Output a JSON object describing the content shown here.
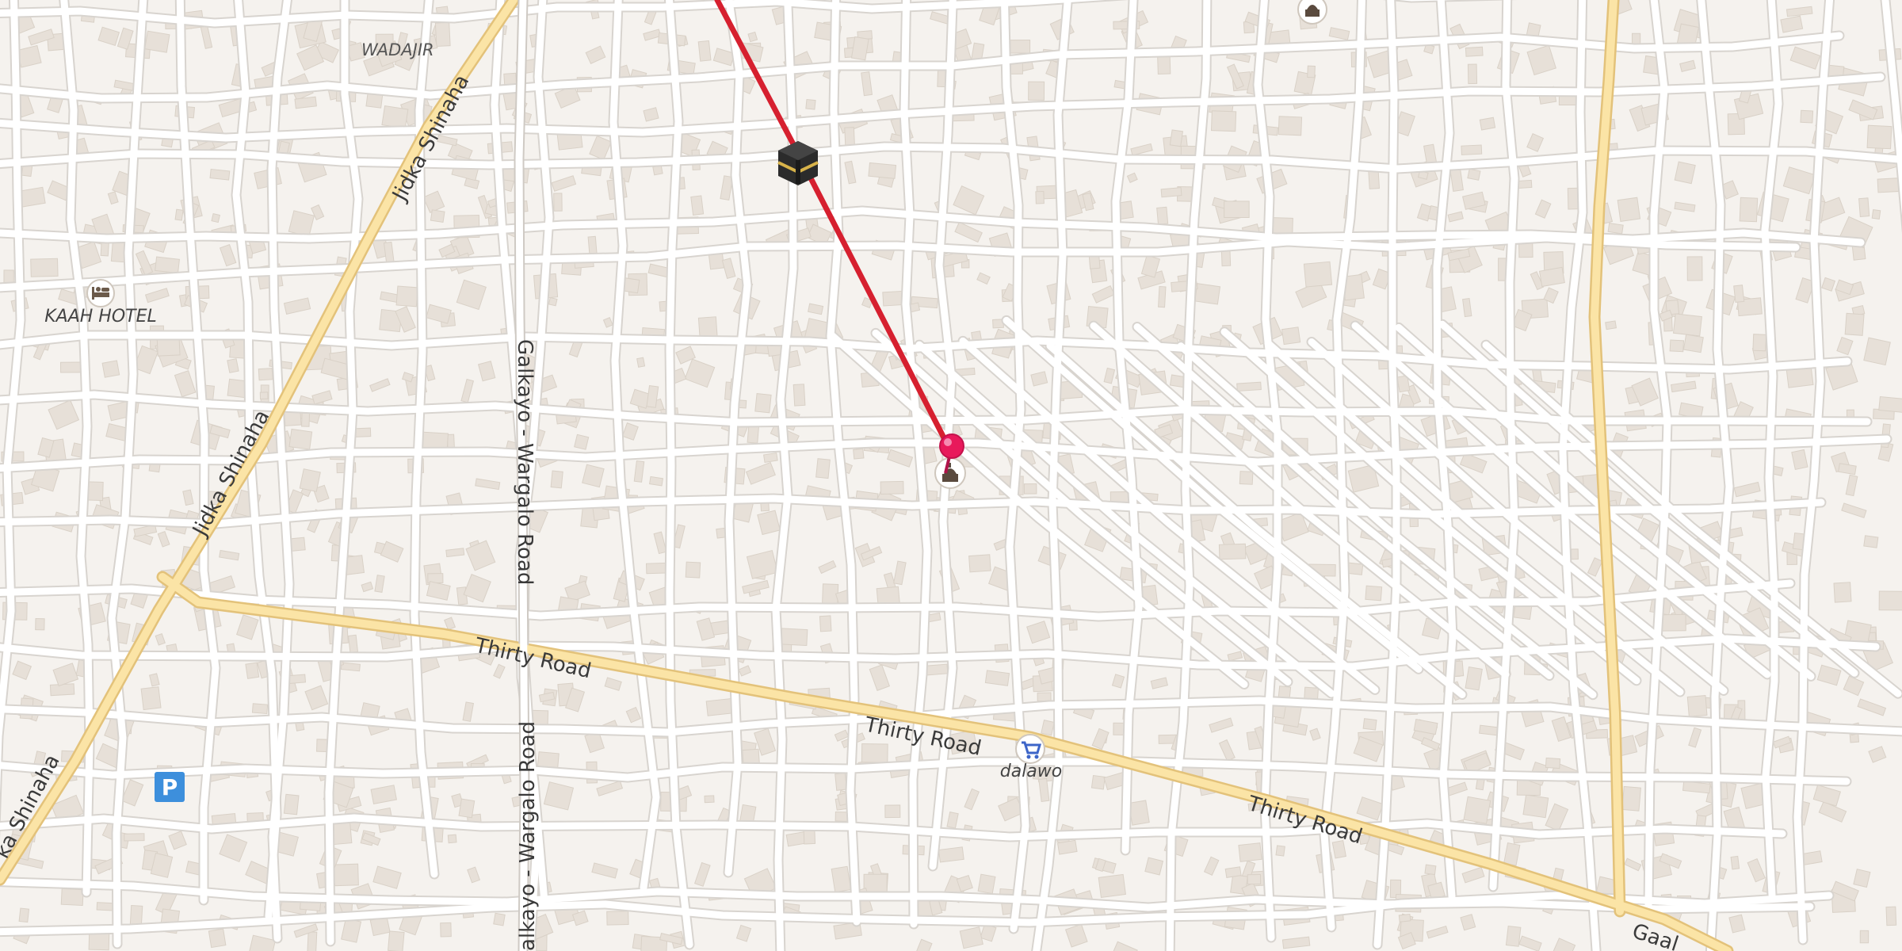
{
  "map": {
    "place_labels": {
      "wadajir": "WADAJIR"
    },
    "road_labels": {
      "jidka_shinaha_1": "Jidka Shinaha",
      "jidka_shinaha_2": "Jidka Shinaha",
      "jidka_shinaha_3": "ka Shinaha",
      "galkayo_wargalo_1": "Galkayo - Wargalo Road",
      "galkayo_wargalo_2": "alkayo - Wargalo Road",
      "thirty_road_1": "Thirty Road",
      "thirty_road_2": "Thirty Road",
      "thirty_road_3": "Thirty Road",
      "gaal": "Gaal"
    },
    "pois": {
      "hotel": {
        "label": "KAAH HOTEL",
        "icon": "bed-icon"
      },
      "shop": {
        "label": "dalawo",
        "icon": "shopping-cart-icon"
      },
      "parking": {
        "glyph": "P",
        "icon": "parking-icon"
      },
      "kaaba": {
        "icon": "kaaba-icon"
      },
      "mosque_center": {
        "icon": "mosque-icon"
      },
      "mosque_top": {
        "icon": "mosque-icon"
      }
    },
    "marker": {
      "icon": "map-pin-icon"
    },
    "colors": {
      "background": "#f5f2ee",
      "road": "#ffffff",
      "major_road": "#fbe3a4",
      "major_road_casing": "#e9c77a",
      "building": "#e6dfd7",
      "route_line": "#d6202f",
      "pin": "#e8195b",
      "parking": "#3d8fdc"
    }
  }
}
